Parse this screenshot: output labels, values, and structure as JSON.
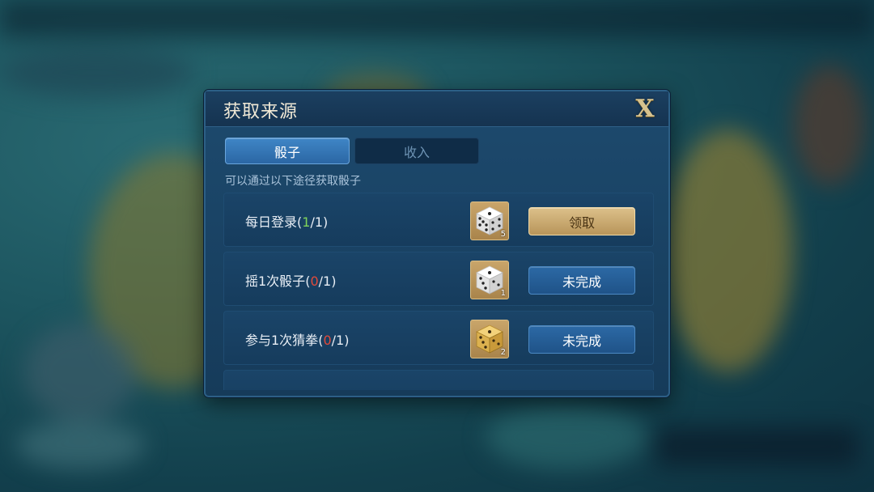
{
  "modal": {
    "title": "获取来源",
    "close_label": "X"
  },
  "tabs": [
    {
      "label": "骰子",
      "active": true
    },
    {
      "label": "收入",
      "active": false
    }
  ],
  "subtitle": "可以通过以下途径获取骰子",
  "tasks": [
    {
      "name": "每日登录",
      "progress_open": "(",
      "progress_done": "1",
      "progress_sep": "/",
      "progress_total": "1",
      "progress_close": ")",
      "progress_state": "complete",
      "reward_icon": "white-dice-icon",
      "reward_count": "5",
      "button_label": "领取",
      "button_style": "gold"
    },
    {
      "name": "摇1次骰子",
      "progress_open": "(",
      "progress_done": "0",
      "progress_sep": "/",
      "progress_total": "1",
      "progress_close": ")",
      "progress_state": "incomplete",
      "reward_icon": "white-dice-icon",
      "reward_count": "1",
      "button_label": "未完成",
      "button_style": "blue"
    },
    {
      "name": "参与1次猜拳",
      "progress_open": "(",
      "progress_done": "0",
      "progress_sep": "/",
      "progress_total": "1",
      "progress_close": ")",
      "progress_state": "incomplete",
      "reward_icon": "gold-dice-icon",
      "reward_count": "2",
      "button_label": "未完成",
      "button_style": "blue"
    }
  ],
  "colors": {
    "complete_count": "#7fd35a",
    "incomplete_count": "#e24a3a",
    "close_icon": "#d6c28e"
  }
}
